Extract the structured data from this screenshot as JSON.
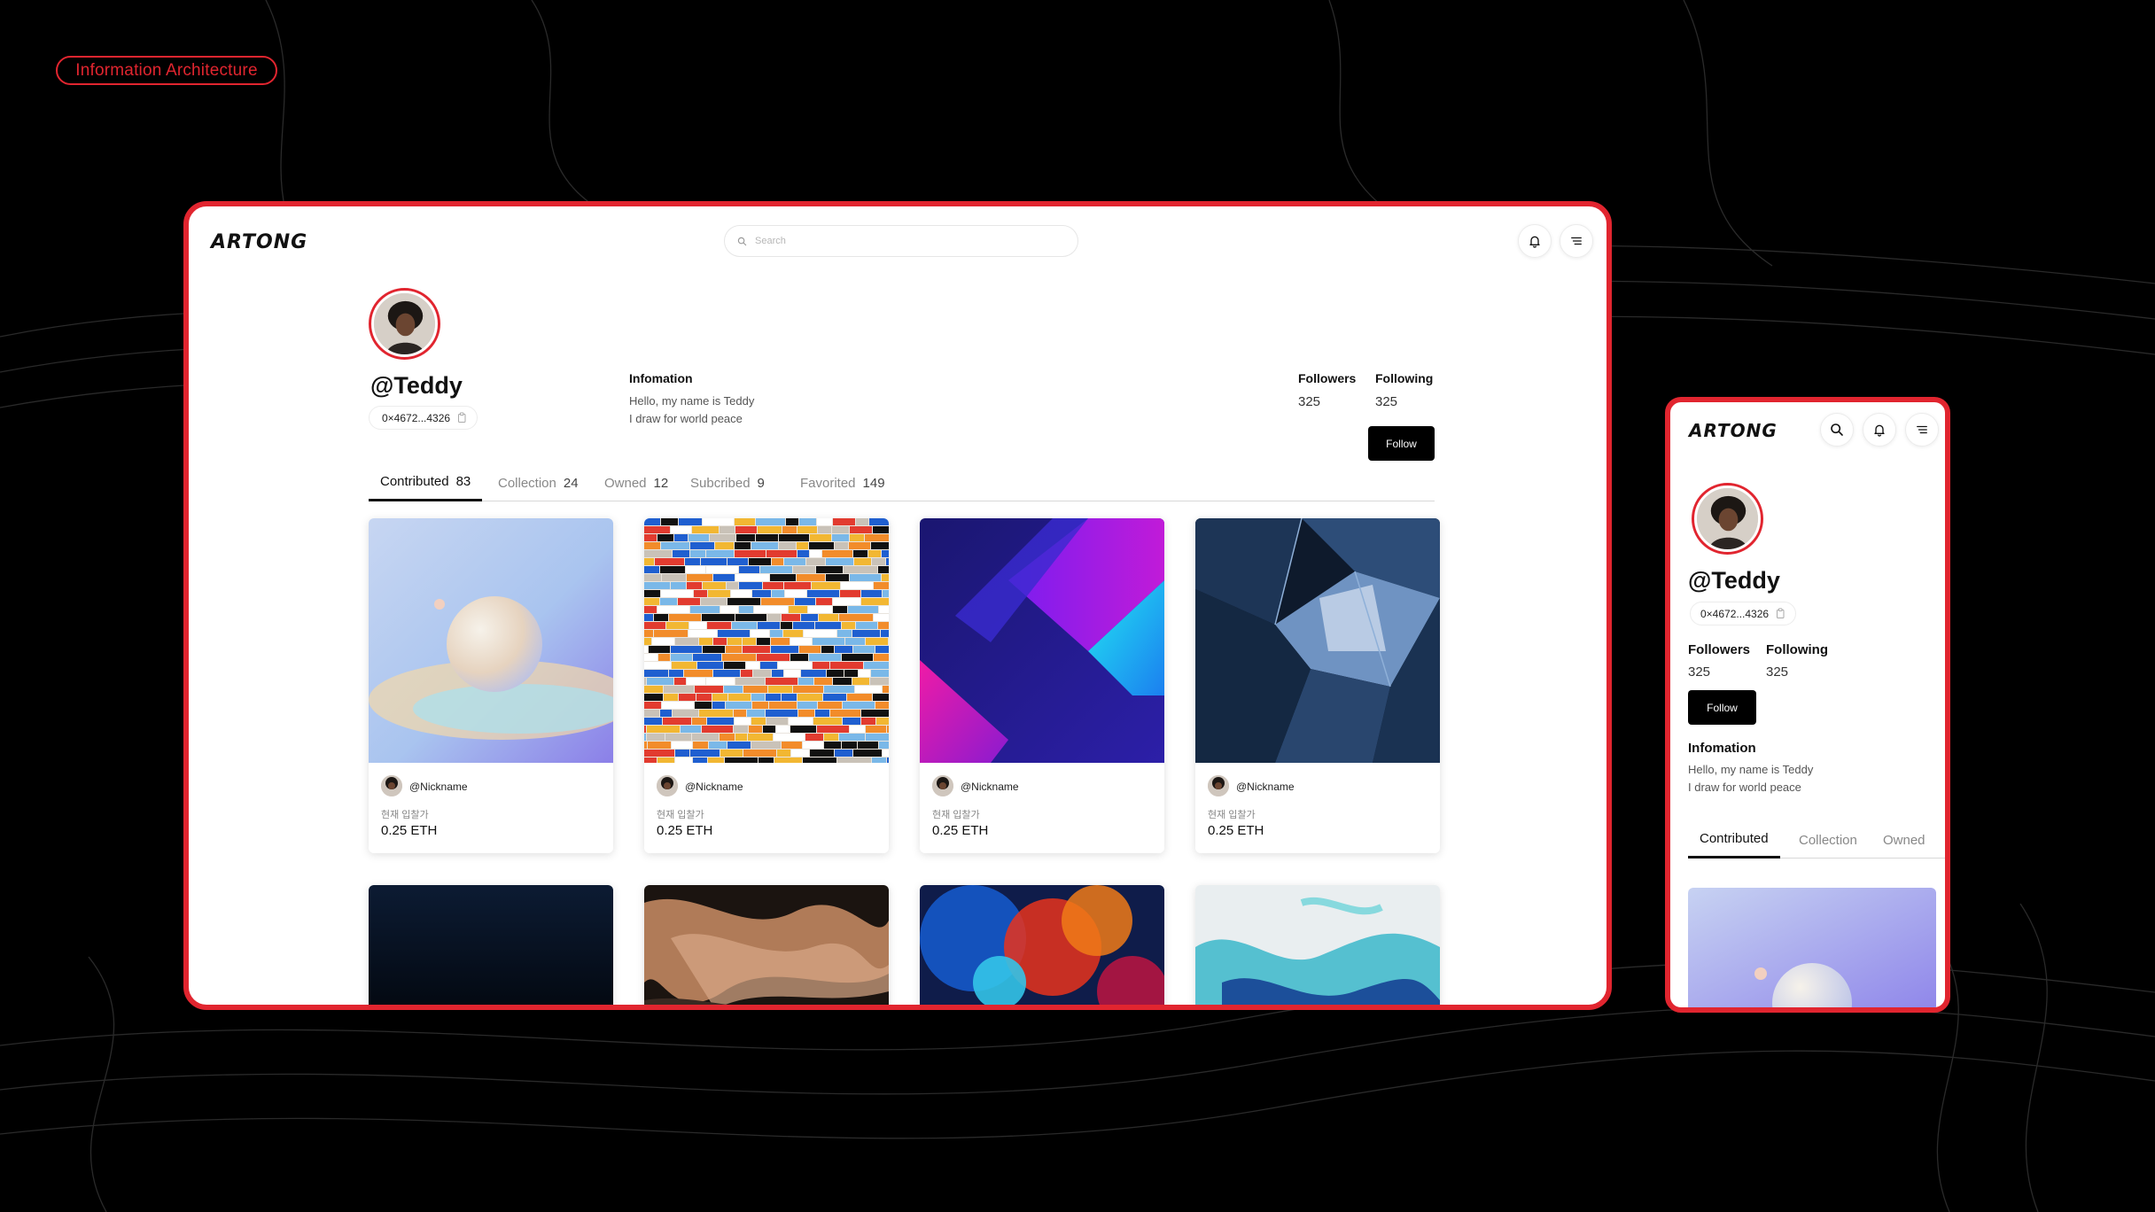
{
  "badge": "Information Architecture",
  "brand": {
    "logo": "ARTONG",
    "accent": "#e1252f"
  },
  "desktop": {
    "search_placeholder": "Search",
    "profile": {
      "handle": "@Teddy",
      "wallet": "0×4672...4326",
      "info_title": "Infomation",
      "info_lines": [
        "Hello, my name is Teddy",
        "I draw for world peace"
      ],
      "followers_label": "Followers",
      "followers": "325",
      "following_label": "Following",
      "following": "325",
      "follow_label": "Follow"
    },
    "tabs": [
      {
        "label": "Contributed",
        "count": "83"
      },
      {
        "label": "Collection",
        "count": "24"
      },
      {
        "label": "Owned",
        "count": "12"
      },
      {
        "label": "Subcribed",
        "count": "9"
      },
      {
        "label": "Favorited",
        "count": "149"
      }
    ],
    "cards": [
      {
        "nickname": "@Nickname",
        "price_label": "현재 입찰가",
        "price": "0.25 ETH"
      },
      {
        "nickname": "@Nickname",
        "price_label": "현재 입찰가",
        "price": "0.25 ETH"
      },
      {
        "nickname": "@Nickname",
        "price_label": "현재 입찰가",
        "price": "0.25 ETH"
      },
      {
        "nickname": "@Nickname",
        "price_label": "현재 입찰가",
        "price": "0.25 ETH"
      }
    ]
  },
  "mobile": {
    "profile": {
      "handle": "@Teddy",
      "wallet": "0×4672...4326",
      "followers_label": "Followers",
      "followers": "325",
      "following_label": "Following",
      "following": "325",
      "follow_label": "Follow",
      "info_title": "Infomation",
      "info_lines": [
        "Hello, my name is Teddy",
        "I draw for world peace"
      ]
    },
    "tabs": [
      {
        "label": "Contributed"
      },
      {
        "label": "Collection"
      },
      {
        "label": "Owned"
      }
    ]
  },
  "icons": [
    "search-icon",
    "bell-icon",
    "menu-icon",
    "copy-icon"
  ]
}
